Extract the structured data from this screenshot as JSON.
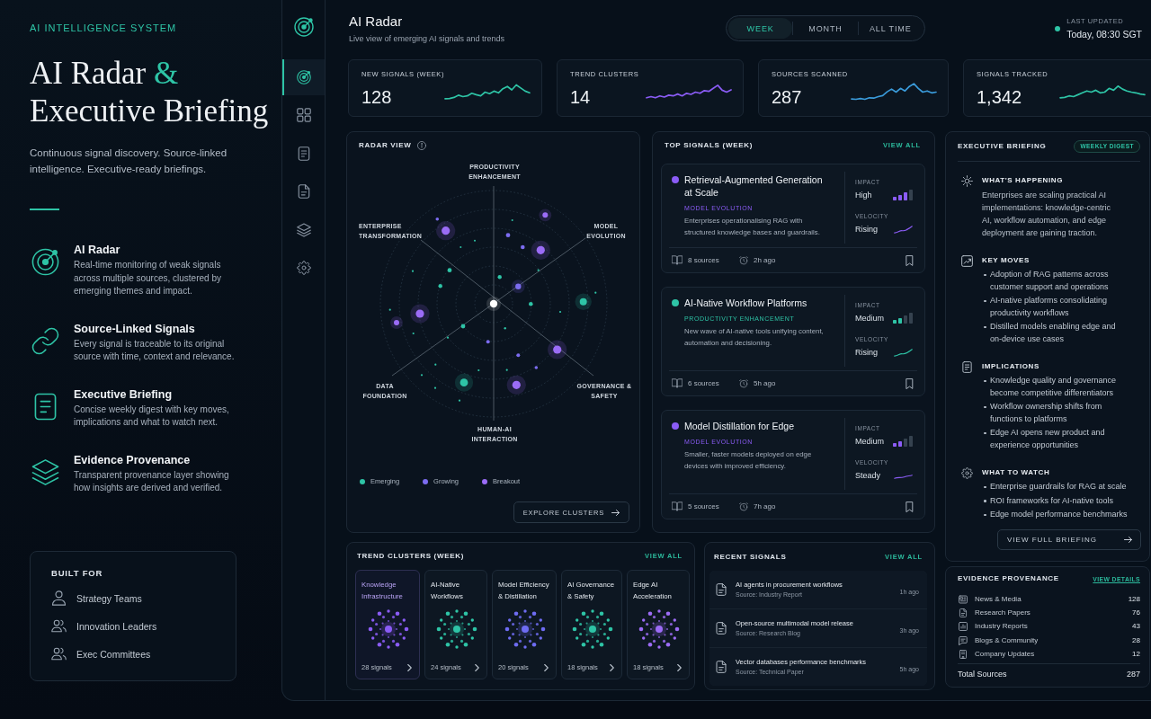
{
  "hero": {
    "eyebrow": "AI INTELLIGENCE SYSTEM",
    "title": "AI Radar",
    "title_accent": "&",
    "title_end": "Executive Briefing",
    "subtitle": "Continuous signal discovery. Source-linked intelligence. Executive-ready briefings.",
    "features": [
      {
        "kind": "radar",
        "title": "AI Radar",
        "text": "Real-time monitoring of weak signals across multiple sources, clustered by emerging themes and impact."
      },
      {
        "kind": "links",
        "title": "Source-Linked Signals",
        "text": "Every signal is traceable to its original source with time, context and relevance."
      },
      {
        "kind": "briefing",
        "title": "Executive Briefing",
        "text": "Concise weekly digest with key moves, implications and what to watch next."
      },
      {
        "kind": "provenance",
        "title": "Evidence Provenance",
        "text": "Transparent provenance layer showing how insights are derived and verified."
      }
    ],
    "built_for": {
      "title": "BUILT FOR",
      "items": [
        {
          "kind": "single",
          "label": "Strategy Teams"
        },
        {
          "kind": "group",
          "label": "Innovation Leaders"
        },
        {
          "kind": "group",
          "label": "Exec Committees"
        }
      ]
    }
  },
  "rail": {
    "items": [
      {
        "kind": "radar",
        "selected": true
      },
      {
        "kind": "clusters",
        "selected": false
      },
      {
        "kind": "briefing",
        "selected": false
      },
      {
        "kind": "reports",
        "selected": false
      },
      {
        "kind": "provenance",
        "selected": false
      },
      {
        "kind": "settings",
        "selected": false
      }
    ]
  },
  "header": {
    "title": "AI Radar",
    "subtitle": "Live view of emerging AI signals and trends",
    "periods": [
      {
        "label": "WEEK",
        "selected": true
      },
      {
        "label": "MONTH",
        "selected": false
      },
      {
        "label": "ALL TIME",
        "selected": false
      }
    ],
    "updated_label": "LAST UPDATED",
    "updated_value": "Today, 08:30 SGT"
  },
  "stats": [
    {
      "label": "NEW SIGNALS (WEEK)",
      "value": "128",
      "color": "#2ec4a6"
    },
    {
      "label": "TREND CLUSTERS",
      "value": "14",
      "color": "#8b5cf6"
    },
    {
      "label": "SOURCES SCANNED",
      "value": "287",
      "color": "#3a9ad9"
    },
    {
      "label": "SIGNALS TRACKED",
      "value": "1,342",
      "color": "#2ec4a6"
    }
  ],
  "radar": {
    "title": "RADAR VIEW",
    "axes": [
      "PRODUCTIVITY ENHANCEMENT",
      "ENTERPRISE TRANSFORMATION",
      "MODEL EVOLUTION",
      "DATA FOUNDATION",
      "GOVERNANCE & SAFETY",
      "HUMAN-AI INTERACTION"
    ],
    "legend": [
      {
        "label": "Emerging",
        "color": "#2ec4a6"
      },
      {
        "label": "Growing",
        "color": "#7c6cf0"
      },
      {
        "label": "Breakout",
        "color": "#9b6cf6"
      }
    ],
    "button": "EXPLORE CLUSTERS"
  },
  "top_signals": {
    "title": "TOP SIGNALS (WEEK)",
    "link": "VIEW ALL",
    "items": [
      {
        "title": "Retrieval-Augmented Generation at Scale",
        "category": "MODEL EVOLUTION",
        "color": "#8b5cf6",
        "text": "Enterprises operationalising RAG with structured knowledge bases and guardrails.",
        "impact": {
          "label": "IMPACT",
          "value": "High",
          "level": 0.75
        },
        "velocity": {
          "label": "VELOCITY",
          "value": "Rising",
          "kind": "up"
        },
        "sources": "8 sources",
        "time": "2h ago"
      },
      {
        "title": "AI-Native Workflow Platforms",
        "category": "PRODUCTIVITY ENHANCEMENT",
        "color": "#2ec4a6",
        "text": "New wave of AI-native tools unifying content, automation and decisioning.",
        "impact": {
          "label": "IMPACT",
          "value": "Medium",
          "level": 0.5
        },
        "velocity": {
          "label": "VELOCITY",
          "value": "Rising",
          "kind": "up"
        },
        "sources": "6 sources",
        "time": "5h ago"
      },
      {
        "title": "Model Distillation for Edge",
        "category": "MODEL EVOLUTION",
        "color": "#8b5cf6",
        "text": "Smaller, faster models deployed on edge devices with improved efficiency.",
        "impact": {
          "label": "IMPACT",
          "value": "Medium",
          "level": 0.5
        },
        "velocity": {
          "label": "VELOCITY",
          "value": "Steady",
          "kind": "flat"
        },
        "sources": "5 sources",
        "time": "7h ago"
      }
    ]
  },
  "briefing": {
    "title": "EXECUTIVE BRIEFING",
    "badge": "WEEKLY DIGEST",
    "sections": [
      {
        "kind": "summary",
        "heading": "WHAT'S HAPPENING",
        "text": "Enterprises are scaling practical AI implementations: knowledge-centric AI, workflow automation, and edge deployment are gaining traction."
      },
      {
        "kind": "moves",
        "heading": "KEY MOVES",
        "bullets": [
          "Adoption of RAG patterns across customer support and operations",
          "AI-native platforms consolidating productivity workflows",
          "Distilled models enabling edge and on-device use cases"
        ]
      },
      {
        "kind": "implications",
        "heading": "IMPLICATIONS",
        "bullets": [
          "Knowledge quality and governance become competitive differentiators",
          "Workflow ownership shifts from functions to platforms",
          "Edge AI opens new product and experience opportunities"
        ]
      },
      {
        "kind": "watch",
        "heading": "WHAT TO WATCH",
        "bullets": [
          "Enterprise guardrails for RAG at scale",
          "ROI frameworks for AI-native tools",
          "Edge model performance benchmarks"
        ]
      }
    ],
    "button": "VIEW FULL BRIEFING"
  },
  "provenance": {
    "title": "EVIDENCE PROVENANCE",
    "link": "VIEW DETAILS",
    "rows": [
      {
        "kind": "news",
        "label": "News & Media",
        "count": "128"
      },
      {
        "kind": "papers",
        "label": "Research Papers",
        "count": "76"
      },
      {
        "kind": "reports",
        "label": "Industry Reports",
        "count": "43"
      },
      {
        "kind": "blogs",
        "label": "Blogs & Community",
        "count": "28"
      },
      {
        "kind": "company",
        "label": "Company Updates",
        "count": "12"
      }
    ],
    "total_label": "Total Sources",
    "total": "287"
  },
  "clusters": {
    "title": "TREND CLUSTERS (WEEK)",
    "link": "VIEW ALL",
    "items": [
      {
        "title": "Knowledge Infrastructure",
        "count": "28 signals",
        "color": "#8b5cf6",
        "selected": true
      },
      {
        "title": "AI-Native Workflows",
        "count": "24 signals",
        "color": "#2ec4a6",
        "selected": false
      },
      {
        "title": "Model Efficiency & Distillation",
        "count": "20 signals",
        "color": "#6e6cf2",
        "selected": false
      },
      {
        "title": "AI Governance & Safety",
        "count": "18 signals",
        "color": "#2ec4a6",
        "selected": false
      },
      {
        "title": "Edge AI Acceleration",
        "count": "18 signals",
        "color": "#9d6cf6",
        "selected": false
      }
    ]
  },
  "recent": {
    "title": "RECENT SIGNALS",
    "link": "VIEW ALL",
    "items": [
      {
        "title": "AI agents in procurement workflows",
        "source": "Source: Industry Report",
        "time": "1h ago"
      },
      {
        "title": "Open-source multimodal model release",
        "source": "Source: Research Blog",
        "time": "3h ago"
      },
      {
        "title": "Vector databases performance benchmarks",
        "source": "Source: Technical Paper",
        "time": "5h ago"
      }
    ]
  }
}
